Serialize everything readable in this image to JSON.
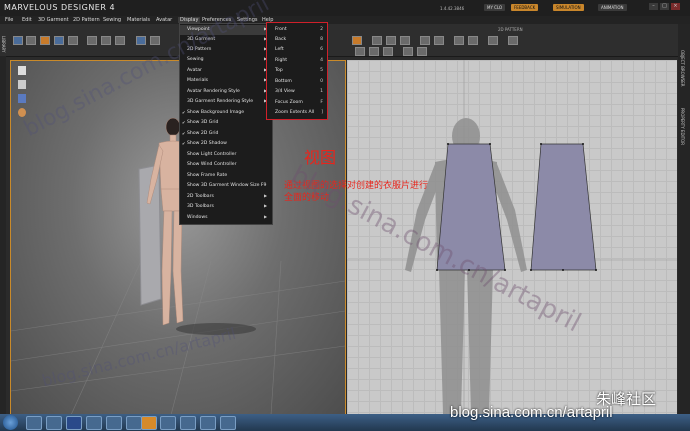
{
  "app": {
    "title": "MARVELOUS DESIGNER 4",
    "version": "1.4.42.3846"
  },
  "titlebar": {
    "my_clo": "MY CLO",
    "feedback": "FEEDBACK",
    "simulation": "SIMULATION",
    "animation": "ANIMATION"
  },
  "menubar": [
    "File",
    "Edit",
    "3D Garment",
    "2D Pattern",
    "Sewing",
    "Materials",
    "Avatar",
    "Display",
    "Preferences",
    "Settings",
    "Help"
  ],
  "panels": {
    "pattern_2d_label": "2D PATTERN",
    "object_browser": "OBJECT BROWSER",
    "property_editor": "PROPERTY EDITOR",
    "library": "LIBRARY"
  },
  "display_menu": [
    {
      "label": "Viewpoint",
      "checked": false,
      "submenu": true
    },
    {
      "label": "3D Garment",
      "checked": false,
      "submenu": true
    },
    {
      "label": "2D Pattern",
      "checked": false,
      "submenu": true
    },
    {
      "label": "Sewing",
      "checked": false,
      "submenu": true
    },
    {
      "label": "Avatar",
      "checked": false,
      "submenu": true
    },
    {
      "label": "Materials",
      "checked": false,
      "submenu": true
    },
    {
      "label": "Avatar Rendering Style",
      "checked": false,
      "submenu": true
    },
    {
      "label": "3D Garment Rendering Style",
      "checked": false,
      "submenu": true
    },
    {
      "label": "Show Background Image",
      "checked": true,
      "submenu": false
    },
    {
      "label": "Show 3D Grid",
      "checked": true,
      "submenu": false
    },
    {
      "label": "Show 2D Grid",
      "checked": true,
      "submenu": false
    },
    {
      "label": "Show 2D Shadow",
      "checked": true,
      "submenu": false
    },
    {
      "label": "Show Light Controller",
      "checked": false,
      "submenu": false
    },
    {
      "label": "Show Wind Controller",
      "checked": false,
      "submenu": false
    },
    {
      "label": "Show Frame Rate",
      "checked": false,
      "submenu": false
    },
    {
      "label": "Show 3D Garment Window Size",
      "shortcut": "F9",
      "checked": false,
      "submenu": false
    },
    {
      "label": "2D Toolbars",
      "checked": false,
      "submenu": true
    },
    {
      "label": "3D Toolbars",
      "checked": false,
      "submenu": true
    },
    {
      "label": "Windows",
      "checked": false,
      "submenu": true
    }
  ],
  "viewpoint_submenu": [
    {
      "label": "Front",
      "key": "2"
    },
    {
      "label": "Back",
      "key": "8"
    },
    {
      "label": "Left",
      "key": "6"
    },
    {
      "label": "Right",
      "key": "4"
    },
    {
      "label": "Top",
      "key": "5"
    },
    {
      "label": "Bottom",
      "key": "0"
    },
    {
      "label": "3/4 View",
      "key": "1"
    },
    {
      "label": "Focus Zoom",
      "key": "F"
    },
    {
      "label": "Zoom Extents All",
      "key": "]"
    }
  ],
  "annotation": {
    "title": "视图",
    "description": "通过视图的选择对创建的衣服片进行\n全面的移动"
  },
  "watermarks": {
    "blog": "blog.sina.com.cn/artapril",
    "site": "blog.sina.com.cn/artapril",
    "community": "朱峰社区"
  },
  "colors": {
    "accent_orange": "#c98a2a",
    "menu_highlight_border": "#d0202a",
    "annotation_red": "#e8251c",
    "pattern_fill": "#8c8aa8"
  }
}
